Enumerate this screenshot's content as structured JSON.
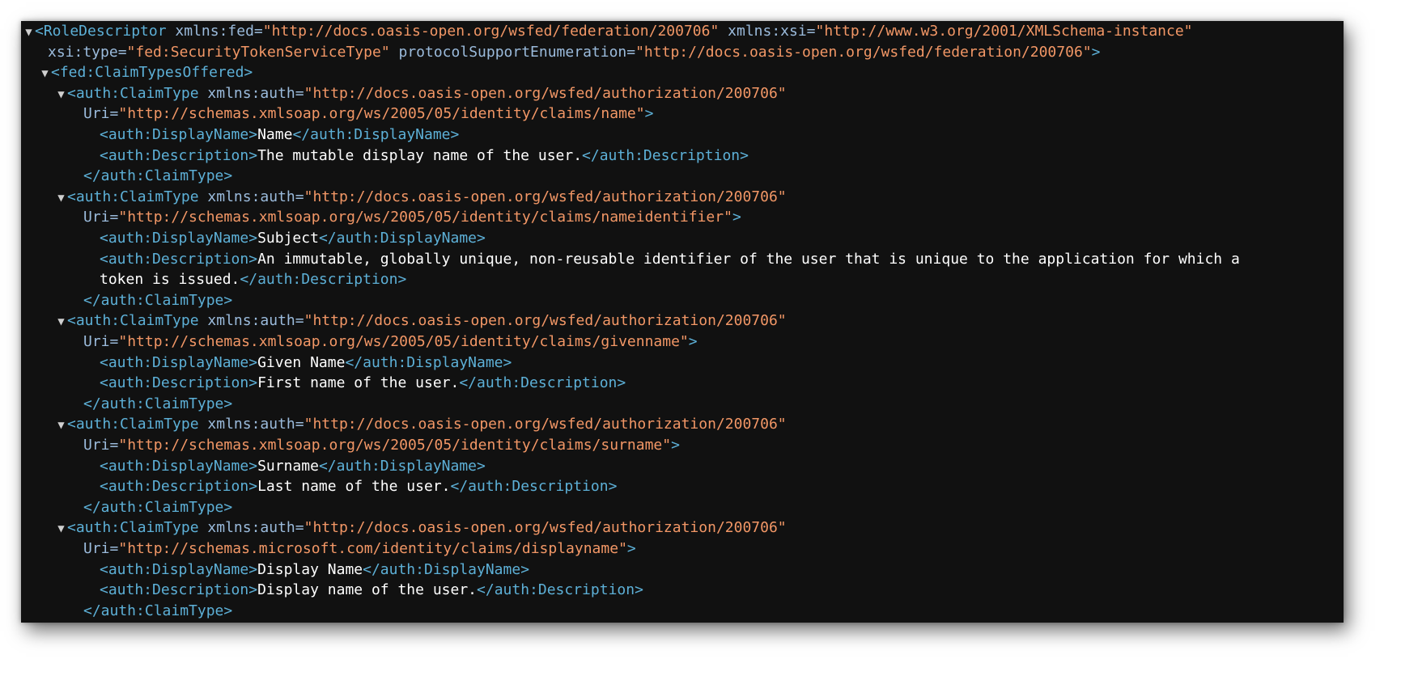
{
  "colors": {
    "background": "#111111",
    "tag": "#5db0d7",
    "attribute": "#9bbbdc",
    "value": "#f29766",
    "text": "#ffffff"
  },
  "icons": {
    "expand_toggle": "triangle-down-icon",
    "glyph": "▼"
  },
  "lines": [
    {
      "indent": 0,
      "toggle": true,
      "tokens": [
        {
          "k": "tag",
          "t": "<RoleDescriptor"
        },
        {
          "k": "attr",
          "t": " xmlns:fed="
        },
        {
          "k": "val",
          "t": "\"http://docs.oasis-open.org/wsfed/federation/200706\""
        },
        {
          "k": "attr",
          "t": " xmlns:xsi="
        },
        {
          "k": "val",
          "t": "\"http://www.w3.org/2001/XMLSchema-instance\""
        }
      ]
    },
    {
      "indent": 16,
      "toggle": false,
      "tokens": [
        {
          "k": "attr",
          "t": "xsi:type="
        },
        {
          "k": "val",
          "t": "\"fed:SecurityTokenServiceType\""
        },
        {
          "k": "attr",
          "t": " protocolSupportEnumeration="
        },
        {
          "k": "val",
          "t": "\"http://docs.oasis-open.org/wsfed/federation/200706\""
        },
        {
          "k": "tag",
          "t": ">"
        }
      ]
    },
    {
      "indent": 20,
      "toggle": true,
      "tokens": [
        {
          "k": "tag",
          "t": "<fed:ClaimTypesOffered>"
        }
      ]
    },
    {
      "indent": 40,
      "toggle": true,
      "tokens": [
        {
          "k": "tag",
          "t": "<auth:ClaimType"
        },
        {
          "k": "attr",
          "t": " xmlns:auth="
        },
        {
          "k": "val",
          "t": "\"http://docs.oasis-open.org/wsfed/authorization/200706\""
        }
      ]
    },
    {
      "indent": 60,
      "toggle": false,
      "tokens": [
        {
          "k": "attr",
          "t": "Uri="
        },
        {
          "k": "val",
          "t": "\"http://schemas.xmlsoap.org/ws/2005/05/identity/claims/name\""
        },
        {
          "k": "tag",
          "t": ">"
        }
      ]
    },
    {
      "indent": 80,
      "toggle": false,
      "tokens": [
        {
          "k": "tag",
          "t": "<auth:DisplayName>"
        },
        {
          "k": "txt",
          "t": "Name"
        },
        {
          "k": "tag",
          "t": "</auth:DisplayName>"
        }
      ]
    },
    {
      "indent": 80,
      "toggle": false,
      "tokens": [
        {
          "k": "tag",
          "t": "<auth:Description>"
        },
        {
          "k": "txt",
          "t": "The mutable display name of the user."
        },
        {
          "k": "tag",
          "t": "</auth:Description>"
        }
      ]
    },
    {
      "indent": 60,
      "toggle": false,
      "tokens": [
        {
          "k": "tag",
          "t": "</auth:ClaimType>"
        }
      ]
    },
    {
      "indent": 40,
      "toggle": true,
      "tokens": [
        {
          "k": "tag",
          "t": "<auth:ClaimType"
        },
        {
          "k": "attr",
          "t": " xmlns:auth="
        },
        {
          "k": "val",
          "t": "\"http://docs.oasis-open.org/wsfed/authorization/200706\""
        }
      ]
    },
    {
      "indent": 60,
      "toggle": false,
      "tokens": [
        {
          "k": "attr",
          "t": "Uri="
        },
        {
          "k": "val",
          "t": "\"http://schemas.xmlsoap.org/ws/2005/05/identity/claims/nameidentifier\""
        },
        {
          "k": "tag",
          "t": ">"
        }
      ]
    },
    {
      "indent": 80,
      "toggle": false,
      "tokens": [
        {
          "k": "tag",
          "t": "<auth:DisplayName>"
        },
        {
          "k": "txt",
          "t": "Subject"
        },
        {
          "k": "tag",
          "t": "</auth:DisplayName>"
        }
      ]
    },
    {
      "indent": 80,
      "toggle": false,
      "tokens": [
        {
          "k": "tag",
          "t": "<auth:Description>"
        },
        {
          "k": "txt",
          "t": "An immutable, globally unique, non-reusable identifier of the user that is unique to the application for which a"
        }
      ]
    },
    {
      "indent": 80,
      "toggle": false,
      "tokens": [
        {
          "k": "txt",
          "t": "token is issued."
        },
        {
          "k": "tag",
          "t": "</auth:Description>"
        }
      ]
    },
    {
      "indent": 60,
      "toggle": false,
      "tokens": [
        {
          "k": "tag",
          "t": "</auth:ClaimType>"
        }
      ]
    },
    {
      "indent": 40,
      "toggle": true,
      "tokens": [
        {
          "k": "tag",
          "t": "<auth:ClaimType"
        },
        {
          "k": "attr",
          "t": " xmlns:auth="
        },
        {
          "k": "val",
          "t": "\"http://docs.oasis-open.org/wsfed/authorization/200706\""
        }
      ]
    },
    {
      "indent": 60,
      "toggle": false,
      "tokens": [
        {
          "k": "attr",
          "t": "Uri="
        },
        {
          "k": "val",
          "t": "\"http://schemas.xmlsoap.org/ws/2005/05/identity/claims/givenname\""
        },
        {
          "k": "tag",
          "t": ">"
        }
      ]
    },
    {
      "indent": 80,
      "toggle": false,
      "tokens": [
        {
          "k": "tag",
          "t": "<auth:DisplayName>"
        },
        {
          "k": "txt",
          "t": "Given Name"
        },
        {
          "k": "tag",
          "t": "</auth:DisplayName>"
        }
      ]
    },
    {
      "indent": 80,
      "toggle": false,
      "tokens": [
        {
          "k": "tag",
          "t": "<auth:Description>"
        },
        {
          "k": "txt",
          "t": "First name of the user."
        },
        {
          "k": "tag",
          "t": "</auth:Description>"
        }
      ]
    },
    {
      "indent": 60,
      "toggle": false,
      "tokens": [
        {
          "k": "tag",
          "t": "</auth:ClaimType>"
        }
      ]
    },
    {
      "indent": 40,
      "toggle": true,
      "tokens": [
        {
          "k": "tag",
          "t": "<auth:ClaimType"
        },
        {
          "k": "attr",
          "t": " xmlns:auth="
        },
        {
          "k": "val",
          "t": "\"http://docs.oasis-open.org/wsfed/authorization/200706\""
        }
      ]
    },
    {
      "indent": 60,
      "toggle": false,
      "tokens": [
        {
          "k": "attr",
          "t": "Uri="
        },
        {
          "k": "val",
          "t": "\"http://schemas.xmlsoap.org/ws/2005/05/identity/claims/surname\""
        },
        {
          "k": "tag",
          "t": ">"
        }
      ]
    },
    {
      "indent": 80,
      "toggle": false,
      "tokens": [
        {
          "k": "tag",
          "t": "<auth:DisplayName>"
        },
        {
          "k": "txt",
          "t": "Surname"
        },
        {
          "k": "tag",
          "t": "</auth:DisplayName>"
        }
      ]
    },
    {
      "indent": 80,
      "toggle": false,
      "tokens": [
        {
          "k": "tag",
          "t": "<auth:Description>"
        },
        {
          "k": "txt",
          "t": "Last name of the user."
        },
        {
          "k": "tag",
          "t": "</auth:Description>"
        }
      ]
    },
    {
      "indent": 60,
      "toggle": false,
      "tokens": [
        {
          "k": "tag",
          "t": "</auth:ClaimType>"
        }
      ]
    },
    {
      "indent": 40,
      "toggle": true,
      "tokens": [
        {
          "k": "tag",
          "t": "<auth:ClaimType"
        },
        {
          "k": "attr",
          "t": " xmlns:auth="
        },
        {
          "k": "val",
          "t": "\"http://docs.oasis-open.org/wsfed/authorization/200706\""
        }
      ]
    },
    {
      "indent": 60,
      "toggle": false,
      "tokens": [
        {
          "k": "attr",
          "t": "Uri="
        },
        {
          "k": "val",
          "t": "\"http://schemas.microsoft.com/identity/claims/displayname\""
        },
        {
          "k": "tag",
          "t": ">"
        }
      ]
    },
    {
      "indent": 80,
      "toggle": false,
      "tokens": [
        {
          "k": "tag",
          "t": "<auth:DisplayName>"
        },
        {
          "k": "txt",
          "t": "Display Name"
        },
        {
          "k": "tag",
          "t": "</auth:DisplayName>"
        }
      ]
    },
    {
      "indent": 80,
      "toggle": false,
      "tokens": [
        {
          "k": "tag",
          "t": "<auth:Description>"
        },
        {
          "k": "txt",
          "t": "Display name of the user."
        },
        {
          "k": "tag",
          "t": "</auth:Description>"
        }
      ]
    },
    {
      "indent": 60,
      "toggle": false,
      "tokens": [
        {
          "k": "tag",
          "t": "</auth:ClaimType>"
        }
      ]
    }
  ]
}
